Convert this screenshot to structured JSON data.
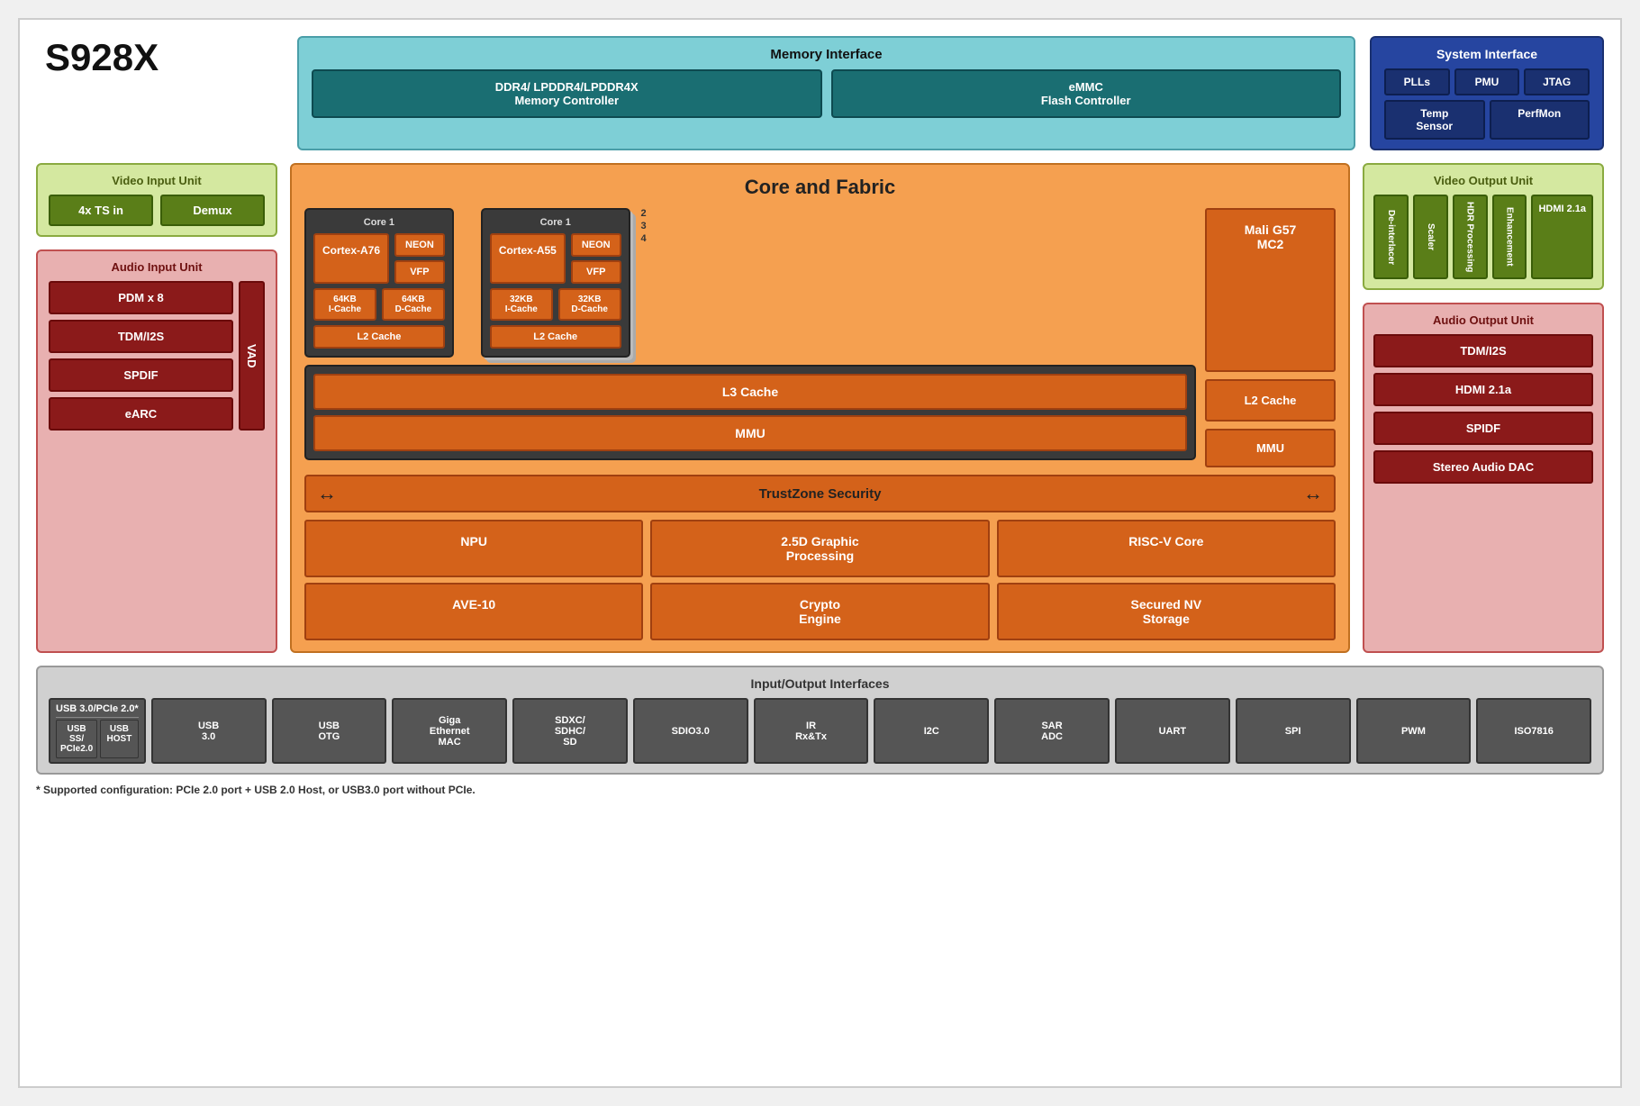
{
  "chip": {
    "title": "S928X"
  },
  "memory_interface": {
    "title": "Memory Interface",
    "ddr": "DDR4/ LPDDR4/LPDDR4X\nMemory Controller",
    "emmc": "eMMC\nFlash Controller"
  },
  "system_interface": {
    "title": "System Interface",
    "plls": "PLLs",
    "pmu": "PMU",
    "jtag": "JTAG",
    "temp_sensor": "Temp\nSensor",
    "perfmon": "PerfMon"
  },
  "video_input": {
    "title": "Video Input Unit",
    "ts_in": "4x TS in",
    "demux": "Demux"
  },
  "audio_input": {
    "title": "Audio Input Unit",
    "pdm": "PDM x 8",
    "tdm": "TDM/I2S",
    "spdif": "SPDIF",
    "earc": "eARC",
    "vad": "VAD"
  },
  "core_fabric": {
    "title": "Core and Fabric",
    "core1_a76": {
      "label": "Core 1",
      "cpu": "Cortex-A76",
      "neon": "NEON",
      "vfp": "VFP",
      "icache": "64KB\nI-Cache",
      "dcache": "64KB\nD-Cache",
      "l2": "L2 Cache"
    },
    "core1_a55": {
      "label": "Core 1",
      "cpu": "Cortex-A55",
      "neon": "NEON",
      "vfp": "VFP",
      "icache": "32KB\nI-Cache",
      "dcache": "32KB\nD-Cache",
      "l2": "L2 Cache",
      "stack_2": "2",
      "stack_3": "3",
      "stack_4": "4"
    },
    "mali": {
      "gpu": "Mali G57\nMC2",
      "l2": "L2 Cache",
      "mmu": "MMU"
    },
    "l3": "L3 Cache",
    "mmu": "MMU",
    "trustzone": "TrustZone Security",
    "npu": "NPU",
    "graphic": "2.5D Graphic\nProcessing",
    "risc_v": "RISC-V Core",
    "ave10": "AVE-10",
    "crypto": "Crypto\nEngine",
    "secured_nv": "Secured NV\nStorage"
  },
  "video_output": {
    "title": "Video Output Unit",
    "deinterlacer": "De-interlacer",
    "scaler": "Scaler",
    "hdr": "HDR Processing",
    "enhancement": "Enhancement",
    "hdmi": "HDMI 2.1a"
  },
  "audio_output": {
    "title": "Audio Output Unit",
    "tdm": "TDM/I2S",
    "hdmi": "HDMI 2.1a",
    "spidf": "SPIDF",
    "stereo": "Stereo Audio DAC"
  },
  "io": {
    "title": "Input/Output Interfaces",
    "usb_pcie": "USB 3.0/PCIe 2.0*",
    "usb_ss": "USB SS/\nPCIe2.0",
    "usb_host": "USB\nHOST",
    "usb_30": "USB\n3.0",
    "usb_otg": "USB\nOTG",
    "giga_ethernet": "Giga\nEthernet\nMAC",
    "sdxc": "SDXC/\nSDHC/\nSD",
    "sdio": "SDIO3.0",
    "ir": "IR\nRx&Tx",
    "i2c": "I2C",
    "sar_adc": "SAR\nADC",
    "uart": "UART",
    "spi": "SPI",
    "pwm": "PWM",
    "iso7816": "ISO7816"
  },
  "footnote": "* Supported configuration: PCIe 2.0 port + USB 2.0 Host, or USB3.0 port without PCIe."
}
